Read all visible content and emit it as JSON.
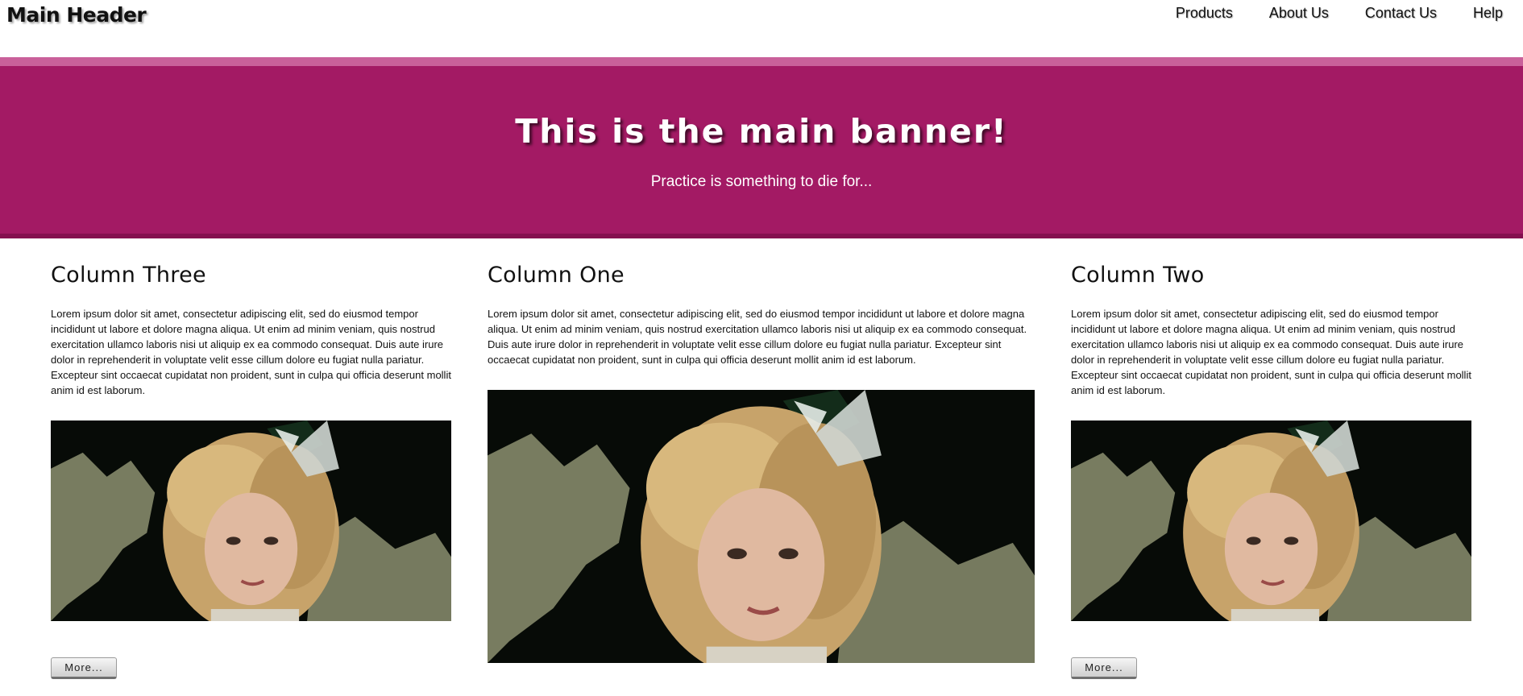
{
  "header": {
    "brand": "Main Header",
    "nav": [
      "Products",
      "About Us",
      "Contact Us",
      "Help"
    ]
  },
  "banner": {
    "title": "This is the main banner!",
    "subtitle": "Practice is something to die for..."
  },
  "columns": [
    {
      "heading": "Column Three",
      "text": "Lorem ipsum dolor sit amet, consectetur adipiscing elit, sed do eiusmod tempor incididunt ut labore et dolore magna aliqua. Ut enim ad minim veniam, quis nostrud exercitation ullamco laboris nisi ut aliquip ex ea commodo consequat. Duis aute irure dolor in reprehenderit in voluptate velit esse cillum dolore eu fugiat nulla pariatur. Excepteur sint occaecat cupidatat non proident, sunt in culpa qui officia deserunt mollit anim id est laborum.",
      "button": "More..."
    },
    {
      "heading": "Column One",
      "text": "Lorem ipsum dolor sit amet, consectetur adipiscing elit, sed do eiusmod tempor incididunt ut labore et dolore magna aliqua. Ut enim ad minim veniam, quis nostrud exercitation ullamco laboris nisi ut aliquip ex ea commodo consequat. Duis aute irure dolor in reprehenderit in voluptate velit esse cillum dolore eu fugiat nulla pariatur. Excepteur sint occaecat cupidatat non proident, sunt in culpa qui officia deserunt mollit anim id est laborum."
    },
    {
      "heading": "Column Two",
      "text": "Lorem ipsum dolor sit amet, consectetur adipiscing elit, sed do eiusmod tempor incididunt ut labore et dolore magna aliqua. Ut enim ad minim veniam, quis nostrud exercitation ullamco laboris nisi ut aliquip ex ea commodo consequat. Duis aute irure dolor in reprehenderit in voluptate velit esse cillum dolore eu fugiat nulla pariatur. Excepteur sint occaecat cupidatat non proident, sunt in culpa qui officia deserunt mollit anim id est laborum.",
      "button": "More..."
    }
  ],
  "colors": {
    "banner": "#a31a64",
    "banner_top_stripe": "#c9609a",
    "banner_bottom_stripe": "#85104f"
  }
}
